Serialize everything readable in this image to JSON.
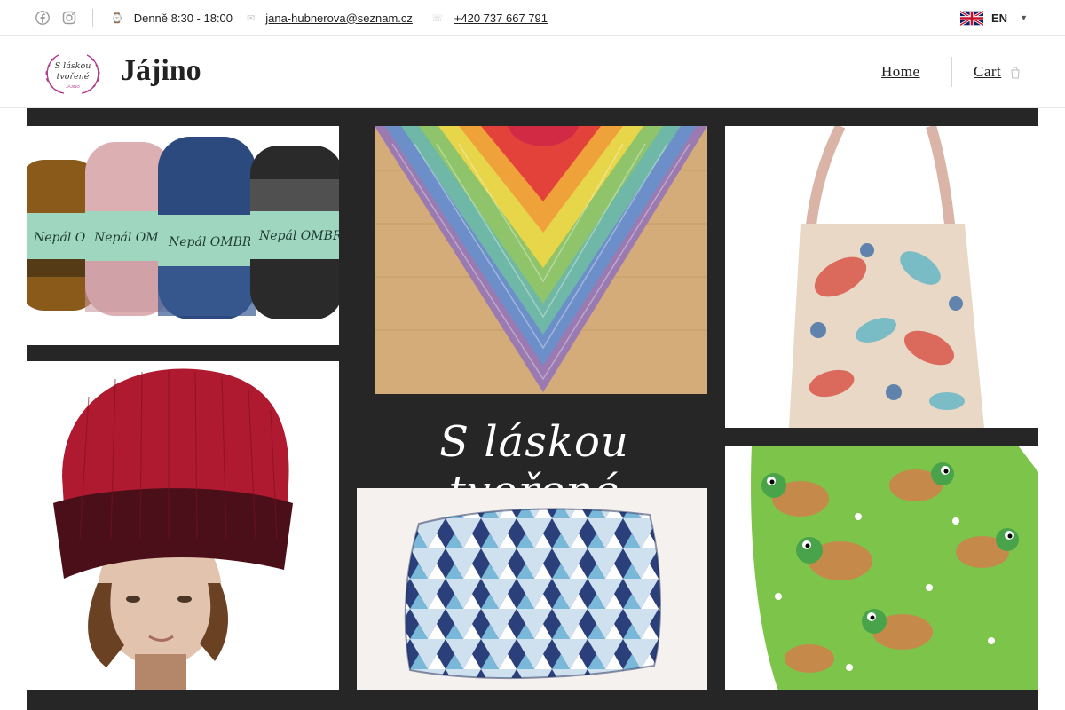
{
  "topbar": {
    "hours": "Denně 8:30 - 18:00",
    "email": "jana-hubnerova@seznam.cz",
    "phone": "+420 737 667 791",
    "language": "EN"
  },
  "header": {
    "logo_text_line1": "S láskou",
    "logo_text_line2": "tvořené",
    "logo_text_line3": "JÁJINO",
    "brand": "Jájino",
    "nav": {
      "home": "Home",
      "cart": "Cart"
    }
  },
  "hero": {
    "title": "S láskou tvořené",
    "yarn_labels": [
      "Nepál OMBRÉ",
      "Nepál OMBRÉ",
      "Nepál OMBRÉ",
      "Nepál OMBRÉ"
    ]
  },
  "colors": {
    "accent_purple": "#b03a8c",
    "collage_bg": "#262626",
    "pillow_green": "#7cc44a"
  },
  "icons": [
    "facebook-icon",
    "instagram-icon",
    "clock-icon",
    "mail-icon",
    "phone-icon",
    "uk-flag-icon",
    "chevron-down-icon",
    "cart-icon"
  ]
}
